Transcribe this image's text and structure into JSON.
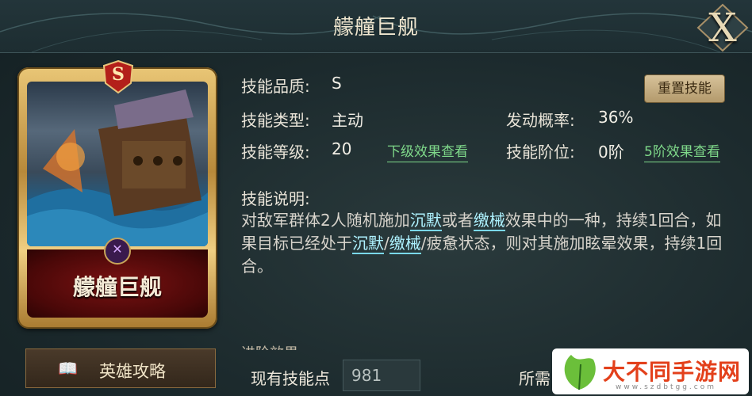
{
  "header": {
    "title": "艨艟巨舰",
    "close_label": "X"
  },
  "card": {
    "grade": "S",
    "name": "艨艟巨舰",
    "class_icon": "crossed-swords-icon"
  },
  "guide_button": {
    "label": "英雄攻略",
    "icon": "book-icon"
  },
  "skill": {
    "quality_label": "技能品质:",
    "quality_value": "S",
    "type_label": "技能类型:",
    "type_value": "主动",
    "chance_label": "发动概率:",
    "chance_value": "36%",
    "level_label": "技能等级:",
    "level_value": "20",
    "next_level_link": "下级效果查看",
    "tier_label": "技能阶位:",
    "tier_value": "0阶",
    "tier5_link": "5阶效果查看",
    "reset_button": "重置技能",
    "desc_title": "技能说明:",
    "desc": {
      "p1": "对敌军群体2人随机施加",
      "kw1": "沉默",
      "p2": "或者",
      "kw2": "缴械",
      "p3": "效果中的一种，持续1回合，如果目标已经处于",
      "kw3": "沉默",
      "p4": "/",
      "kw4": "缴械",
      "p5": "/疲惫状态，则对其施加眩晕效果，持续1回合。"
    },
    "advance_title_partial": "进阶效果"
  },
  "footer": {
    "points_label": "现有技能点",
    "points_value": "981",
    "need_label": "所需"
  },
  "watermark": {
    "text": "大不同手游网",
    "url": "www.szdbtgg.com"
  },
  "colors": {
    "link_green": "#7fd98a",
    "keyword_cyan": "#aef2ff",
    "gold": "#d9b468"
  }
}
